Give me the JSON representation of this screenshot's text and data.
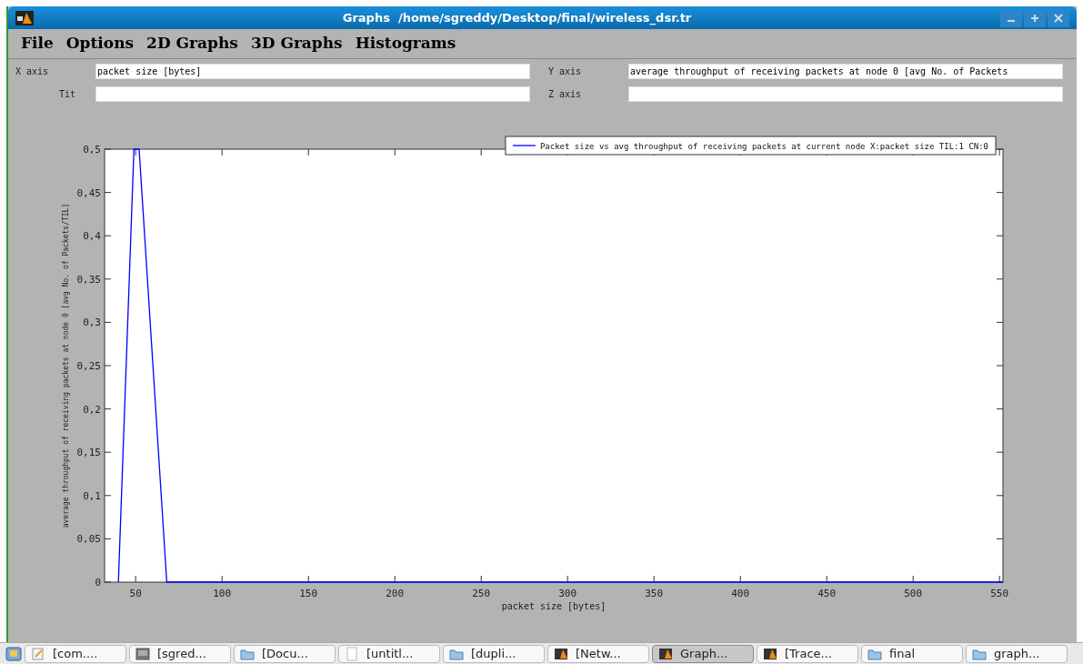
{
  "window": {
    "title": "Graphs  /home/sgreddy/Desktop/final/wireless_dsr.tr"
  },
  "menu": [
    "File",
    "Options",
    "2D Graphs",
    "3D Graphs",
    "Histograms"
  ],
  "fields": [
    {
      "label": "X axis",
      "value": "packet size [bytes]"
    },
    {
      "label": "Y axis",
      "value": "average throughput of receiving packets at node 0 [avg No. of Packets"
    },
    {
      "label": "Tit"
    },
    {
      "label": "Z axis"
    }
  ],
  "chart_data": {
    "type": "line",
    "xlabel": "packet size [bytes]",
    "ylabel": "average throughput of receiving packets at node 0 [avg No. of Packets/TIL]",
    "x": [
      40,
      49,
      52,
      68,
      552
    ],
    "series": [
      {
        "name": "Packet size vs avg throughput of receiving packets at current node X:packet size TIL:1 CN:0",
        "color": "#0000ff",
        "values": [
          0,
          0.5,
          0.5,
          0,
          0
        ]
      }
    ],
    "xlim": [
      32,
      552
    ],
    "ylim": [
      0,
      0.5
    ],
    "xticks": [
      50,
      100,
      150,
      200,
      250,
      300,
      350,
      400,
      450,
      500,
      550
    ],
    "yticks": [
      0,
      {
        "value": 0.05,
        "label": "0,05"
      },
      {
        "value": 0.1,
        "label": "0,1"
      },
      {
        "value": 0.15,
        "label": "0,15"
      },
      {
        "value": 0.2,
        "label": "0,2"
      },
      {
        "value": 0.25,
        "label": "0,25"
      },
      {
        "value": 0.3,
        "label": "0,3"
      },
      {
        "value": 0.35,
        "label": "0,35"
      },
      {
        "value": 0.4,
        "label": "0,4"
      },
      {
        "value": 0.45,
        "label": "0,45"
      },
      {
        "value": 0.5,
        "label": "0,5"
      }
    ]
  },
  "taskbar": [
    {
      "label": "[com....",
      "kind": "note",
      "selected": false
    },
    {
      "label": "[sgred...",
      "kind": "terminal",
      "selected": false
    },
    {
      "label": "[Docu...",
      "kind": "folder",
      "selected": false
    },
    {
      "label": "[untitl...",
      "kind": "blank",
      "selected": false
    },
    {
      "label": "[dupli...",
      "kind": "folder",
      "selected": false
    },
    {
      "label": "[Netw...",
      "kind": "app",
      "selected": false
    },
    {
      "label": "Graph...",
      "kind": "app",
      "selected": true
    },
    {
      "label": "[Trace...",
      "kind": "app",
      "selected": false
    },
    {
      "label": "final",
      "kind": "folder",
      "selected": false
    },
    {
      "label": "graph...",
      "kind": "folder",
      "selected": false
    }
  ]
}
